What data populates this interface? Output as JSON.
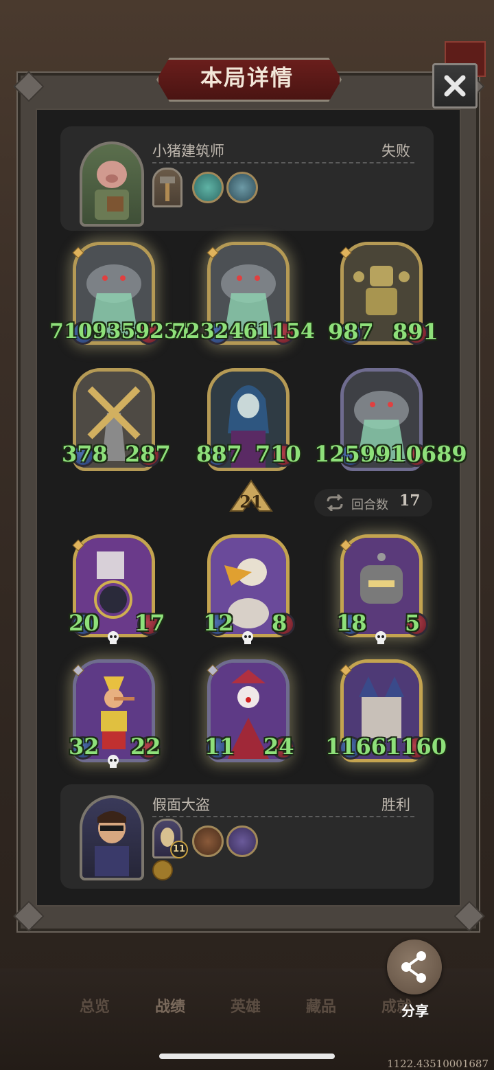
{
  "header": {
    "title": "本局详情",
    "close_icon": "close-x-icon"
  },
  "opponent": {
    "name": "小猪建筑师",
    "result": "失败",
    "portrait": "pig-builder-portrait",
    "hero_power": "hammer-card",
    "items": [
      "blueprint-token",
      "bottle-token"
    ]
  },
  "opponent_board": [
    {
      "attack": "7109359231",
      "health": "7232461154",
      "art": "gray-shark-beast",
      "golden": true
    },
    {
      "attack": "7232461154",
      "health": "",
      "art": "gray-shark-beast",
      "golden": true
    },
    {
      "attack": "987",
      "health": "891",
      "art": "brass-robot",
      "golden": false
    },
    {
      "attack": "378",
      "health": "287",
      "art": "windmill",
      "golden": false
    },
    {
      "attack": "887",
      "health": "710",
      "art": "vampire-lady",
      "golden": false
    },
    {
      "attack": "12599",
      "health": "10689",
      "art": "gray-shark-beast",
      "golden": false
    }
  ],
  "opponent_stat_text": {
    "row1_left": "7109359231",
    "row1_mid": "7232461154",
    "row1_right_atk": "987",
    "row1_right_hp": "891",
    "row2_left_atk": "378",
    "row2_left_hp": "287",
    "row2_mid_atk": "887",
    "row2_mid_hp": "710",
    "row2_right": "1259910689"
  },
  "turn": {
    "tier_value": "21",
    "round_label": "回合数",
    "round_value": "17",
    "round_icon": "repeat-arrows-icon"
  },
  "player_board": [
    {
      "attack": "20",
      "health": "17",
      "art": "bomb-chef"
    },
    {
      "attack": "12",
      "health": "8",
      "art": "pelican"
    },
    {
      "attack": "18",
      "health": "5",
      "art": "iron-robot"
    },
    {
      "attack": "32",
      "health": "22",
      "art": "pinocchio"
    },
    {
      "attack": "11",
      "health": "24",
      "art": "clown"
    },
    {
      "attack": "1166",
      "health": "1160",
      "art": "castle"
    }
  ],
  "player": {
    "name": "假面大盗",
    "result": "胜利",
    "portrait": "masked-thief-portrait",
    "hero_power_count": "11",
    "items": [
      "rock-token",
      "wand-token"
    ]
  },
  "bottom_nav": [
    "总览",
    "战绩",
    "英雄",
    "藏品",
    "成就"
  ],
  "share_label": "分享",
  "version": "1122.43510001687",
  "colors": {
    "stat_green": "#8ee07a",
    "gold_frame": "#b59a55",
    "title_red": "#6a1e1c"
  }
}
